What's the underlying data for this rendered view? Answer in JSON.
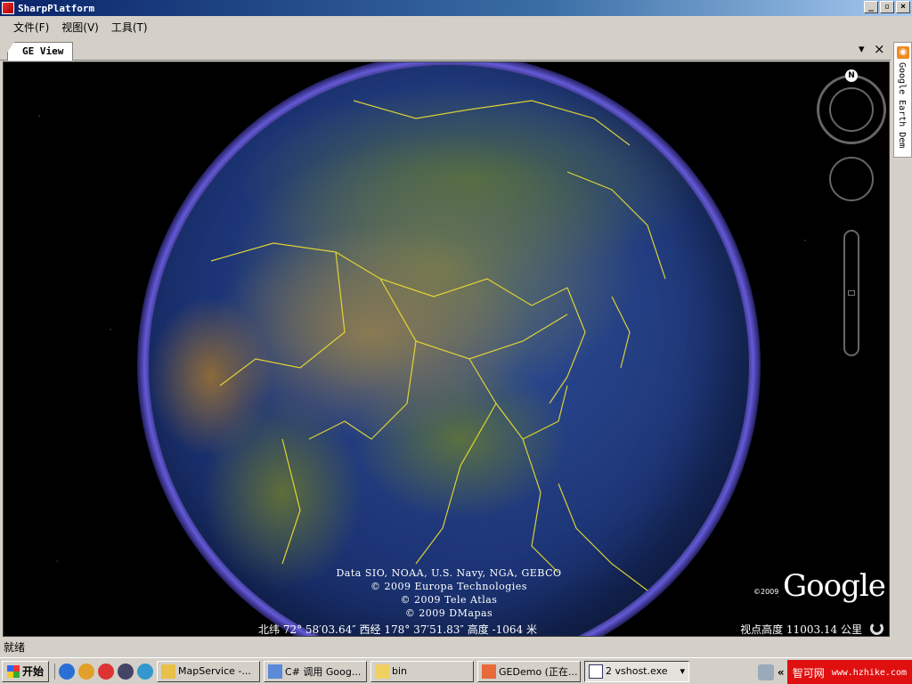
{
  "window": {
    "title": "SharpPlatform",
    "minimize": "_",
    "maximize": "▫",
    "close": "×"
  },
  "menu": {
    "file": "文件(F)",
    "view": "视图(V)",
    "tools": "工具(T)"
  },
  "tab": {
    "label": "GE View",
    "dropdown": "▾",
    "close": "×"
  },
  "map": {
    "attribution": [
      "Data SIO, NOAA, U.S. Navy, NGA, GEBCO",
      "© 2009 Europa Technologies",
      "© 2009 Tele Atlas",
      "© 2009 DMapas"
    ],
    "north_label": "N",
    "coords": "北纬 72° 58′03.64″  西经 178° 37′51.83″ 高度 -1064 米",
    "altitude": "视点高度  11003.14 公里",
    "google_copyright": "©2009",
    "google_logo": "Google"
  },
  "side_panel": {
    "label": "Google Earth Dem"
  },
  "status": {
    "text": "就绪"
  },
  "taskbar": {
    "start": "开始",
    "items": [
      {
        "label": "MapService -..."
      },
      {
        "label": "C# 调用 Goog..."
      },
      {
        "label": "bin"
      },
      {
        "label": "GEDemo (正在..."
      },
      {
        "label": "2 vshost.exe"
      }
    ],
    "tray_chevron": "«",
    "brand_name": "智可网",
    "brand_url": "www.hzhike.com"
  }
}
